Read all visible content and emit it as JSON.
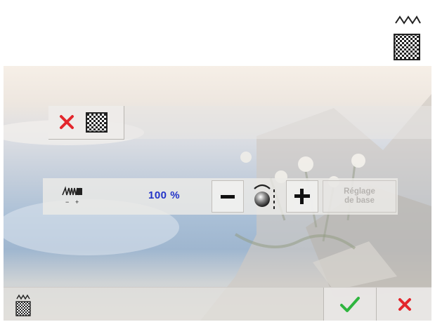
{
  "top_icon": {
    "icon": "pattern-fill-icon"
  },
  "toolbar": {
    "close_icon": "close-x-icon",
    "pattern_icon": "pattern-fill-icon"
  },
  "control": {
    "icon": "stitch-width-icon",
    "minus_label": "-",
    "plus_label": "+",
    "value": "100 %",
    "reset_label_line1": "Réglage",
    "reset_label_line2": "de base"
  },
  "footer": {
    "pattern_icon": "pattern-fill-icon",
    "ok_icon": "checkmark-icon",
    "cancel_icon": "cancel-x-icon"
  },
  "colors": {
    "close": "#e3262c",
    "ok": "#2fb53f",
    "value": "#2233c8"
  }
}
